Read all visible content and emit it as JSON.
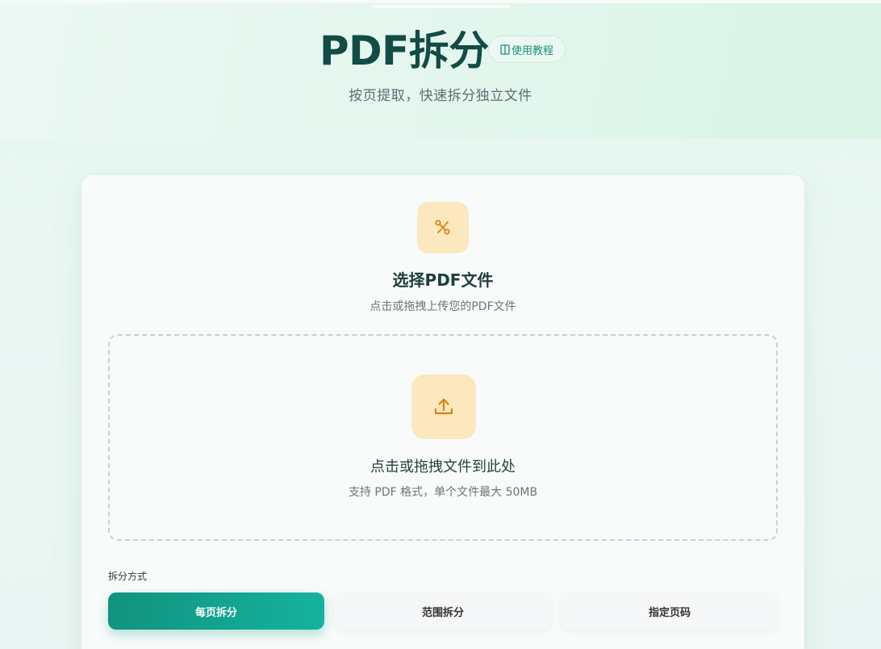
{
  "header": {
    "title": "PDF拆分",
    "tutorial_label": "使用教程",
    "subtitle": "按页提取，快速拆分独立文件"
  },
  "card": {
    "title": "选择PDF文件",
    "subtitle": "点击或拖拽上传您的PDF文件",
    "icon": "scissors-icon"
  },
  "dropzone": {
    "title": "点击或拖拽文件到此处",
    "hint": "支持 PDF 格式，单个文件最大 50MB",
    "icon": "upload-icon"
  },
  "split": {
    "label": "拆分方式",
    "modes": [
      {
        "label": "每页拆分",
        "selected": true
      },
      {
        "label": "范围拆分",
        "selected": false
      },
      {
        "label": "指定页码",
        "selected": false
      }
    ]
  },
  "colors": {
    "accent": "#14a08c",
    "title": "#124c44",
    "icon_bg": "#fbe8be",
    "icon_fg": "#d98114"
  }
}
